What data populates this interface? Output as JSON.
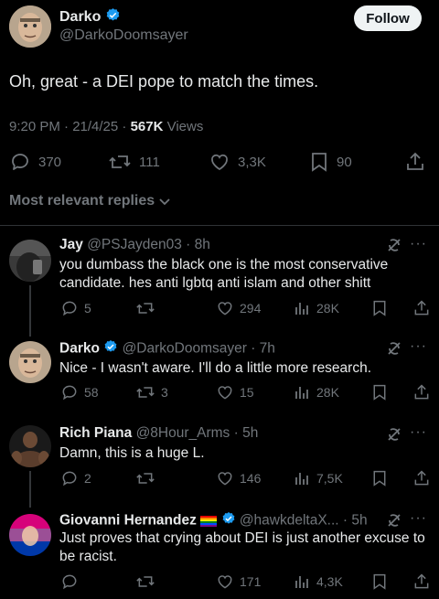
{
  "post": {
    "author_name": "Darko",
    "author_handle": "@DarkoDoomsayer",
    "follow_label": "Follow",
    "text": "Oh, great - a DEI pope to match the times.",
    "time": "9:20 PM · 21/4/25 · ",
    "views_count": "567K",
    "views_label": " Views",
    "stats": {
      "replies": "370",
      "reposts": "111",
      "likes": "3,3K",
      "bookmarks": "90"
    }
  },
  "sort": {
    "label": "Most relevant replies"
  },
  "replies": [
    {
      "name": "Jay",
      "handle": "@PSJayden03",
      "time": "· 8h",
      "text": "you dumbass the black one is the most conservative candidate. hes anti lgbtq anti islam and other shitt",
      "replies": "5",
      "reposts": "",
      "likes": "294",
      "views": "28K"
    },
    {
      "name": "Darko",
      "handle": "@DarkoDoomsayer",
      "time": "· 7h",
      "text": "Nice - I wasn't aware. I'll do a little more research.",
      "replies": "58",
      "reposts": "3",
      "likes": "15",
      "views": "28K"
    },
    {
      "name": "Rich Piana",
      "handle": "@8Hour_Arms",
      "time": "· 5h",
      "text": "Damn, this is a huge L.",
      "replies": "2",
      "reposts": "",
      "likes": "146",
      "views": "7,5K"
    },
    {
      "name": "Giovanni Hernandez",
      "handle": "@hawkdeltaX...",
      "time": "· 5h",
      "text": "Just proves that crying about DEI is just another excuse to be racist.",
      "replies": "",
      "reposts": "",
      "likes": "171",
      "views": "4,3K"
    }
  ],
  "colors": {
    "verified": "#1d9bf0",
    "background": "#000000",
    "muted": "#71767b"
  }
}
